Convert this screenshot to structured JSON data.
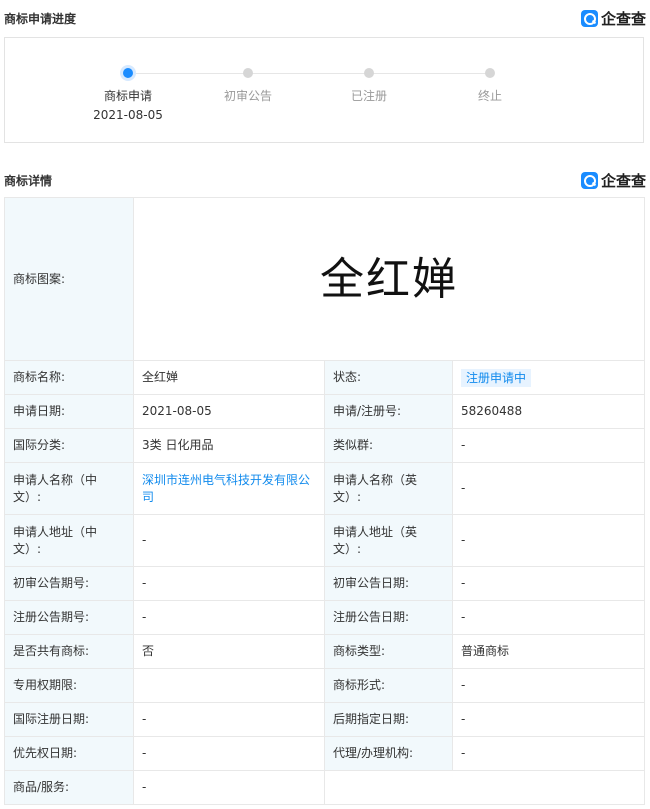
{
  "progress": {
    "title": "商标申请进度",
    "logo_text": "企查查",
    "steps": [
      {
        "label": "商标申请",
        "date": "2021-08-05"
      },
      {
        "label": "初审公告",
        "date": ""
      },
      {
        "label": "已注册",
        "date": ""
      },
      {
        "label": "终止",
        "date": ""
      }
    ],
    "active_step": 0
  },
  "details": {
    "title": "商标详情",
    "logo_text": "企查查",
    "trademark_image_label": "商标图案:",
    "trademark_image_text": "全红婵",
    "rows": [
      {
        "l1": "商标名称:",
        "v1": "全红婵",
        "l2": "状态:",
        "v2": "注册申请中"
      },
      {
        "l1": "申请日期:",
        "v1": "2021-08-05",
        "l2": "申请/注册号:",
        "v2": "58260488"
      },
      {
        "l1": "国际分类:",
        "v1": "3类 日化用品",
        "l2": "类似群:",
        "v2": "-"
      },
      {
        "l1": "申请人名称（中文）:",
        "v1": "深圳市连州电气科技开发有限公司",
        "l2": "申请人名称（英文）:",
        "v2": "-"
      },
      {
        "l1": "申请人地址（中文）:",
        "v1": "-",
        "l2": "申请人地址（英文）:",
        "v2": "-"
      },
      {
        "l1": "初审公告期号:",
        "v1": "-",
        "l2": "初审公告日期:",
        "v2": "-"
      },
      {
        "l1": "注册公告期号:",
        "v1": "-",
        "l2": "注册公告日期:",
        "v2": "-"
      },
      {
        "l1": "是否共有商标:",
        "v1": "否",
        "l2": "商标类型:",
        "v2": "普通商标"
      },
      {
        "l1": "专用权期限:",
        "v1": "",
        "l2": "商标形式:",
        "v2": "-"
      },
      {
        "l1": "国际注册日期:",
        "v1": "-",
        "l2": "后期指定日期:",
        "v2": "-"
      },
      {
        "l1": "优先权日期:",
        "v1": "-",
        "l2": "代理/办理机构:",
        "v2": "-"
      }
    ],
    "goods_label": "商品/服务:",
    "goods_value": "-"
  },
  "colors": {
    "accent": "#128bed",
    "label_bg": "#f2f9fc",
    "border": "#e8e8e8"
  }
}
